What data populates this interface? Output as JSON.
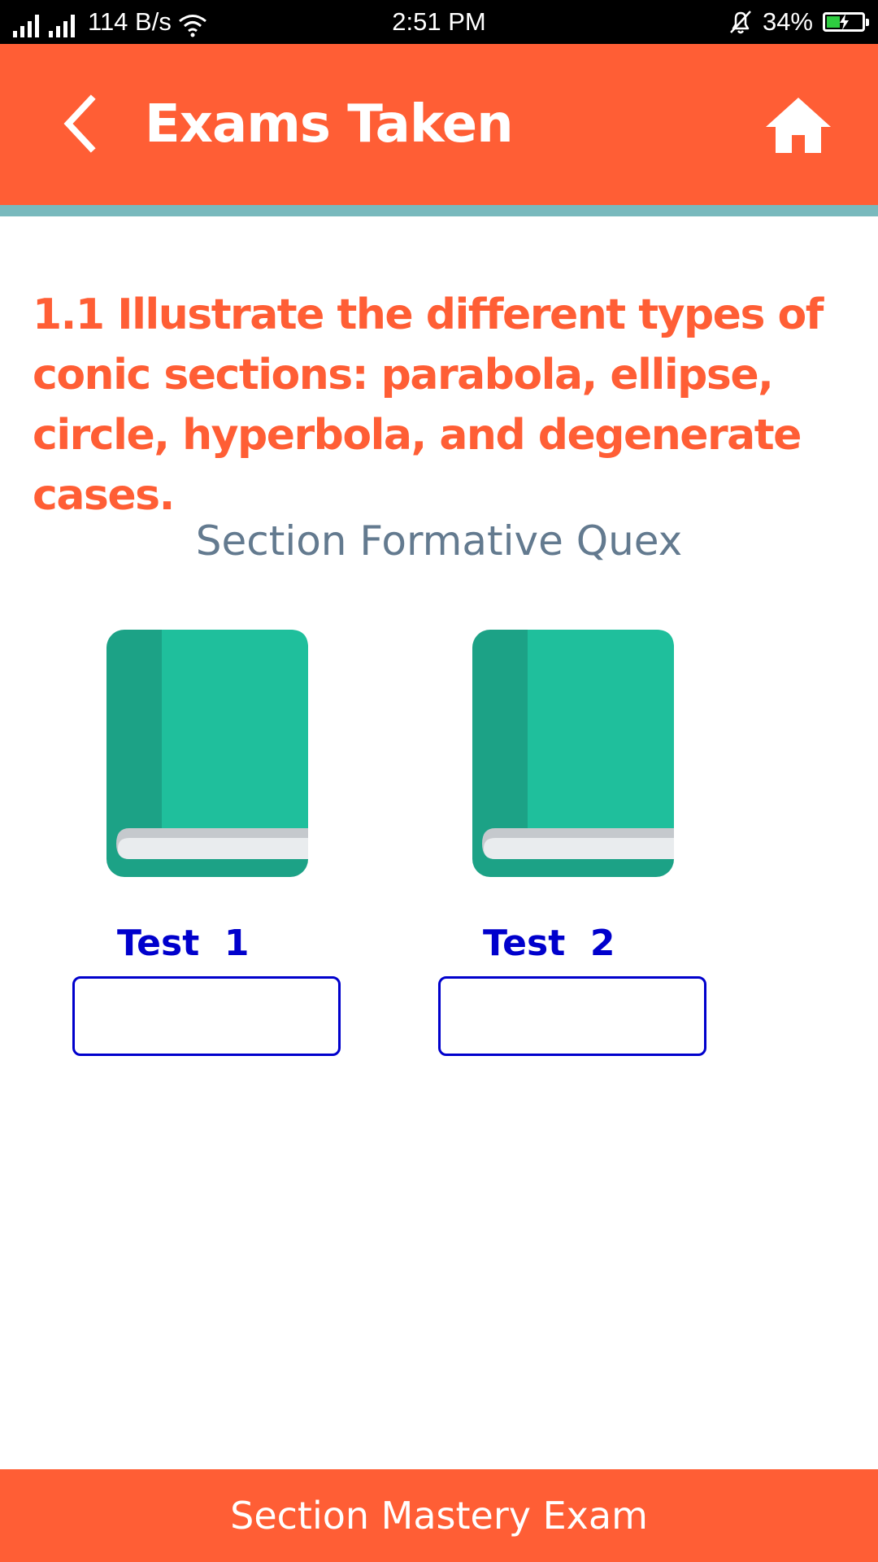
{
  "status_bar": {
    "net_speed": "114 B/s",
    "time": "2:51 PM",
    "battery_percent": "34%",
    "battery_level": 0.34,
    "icons": [
      "signal-icon",
      "signal-icon",
      "wifi-icon",
      "bell-off-icon",
      "battery-charging-icon"
    ]
  },
  "header": {
    "title": "Exams Taken",
    "back_icon": "chevron-left-icon",
    "home_icon": "home-icon",
    "background_color": "#ff5e35",
    "accent_color": "#79b9bd"
  },
  "content": {
    "objective": "1.1 Illustrate the different types of conic sections: parabola, ellipse, circle, hyperbola, and degenerate cases.",
    "section_label": "Section Formative Quex",
    "tests": [
      {
        "label": "Test  1",
        "icon": "book-icon",
        "score": ""
      },
      {
        "label": "Test  2",
        "icon": "book-icon",
        "score": ""
      }
    ]
  },
  "footer": {
    "mastery_button_label": "Section Mastery Exam"
  },
  "colors": {
    "brand_orange": "#ff5e35",
    "test_blue": "#0000cc",
    "book_green": "#1fbf9c",
    "book_spine": "#1ca286"
  }
}
